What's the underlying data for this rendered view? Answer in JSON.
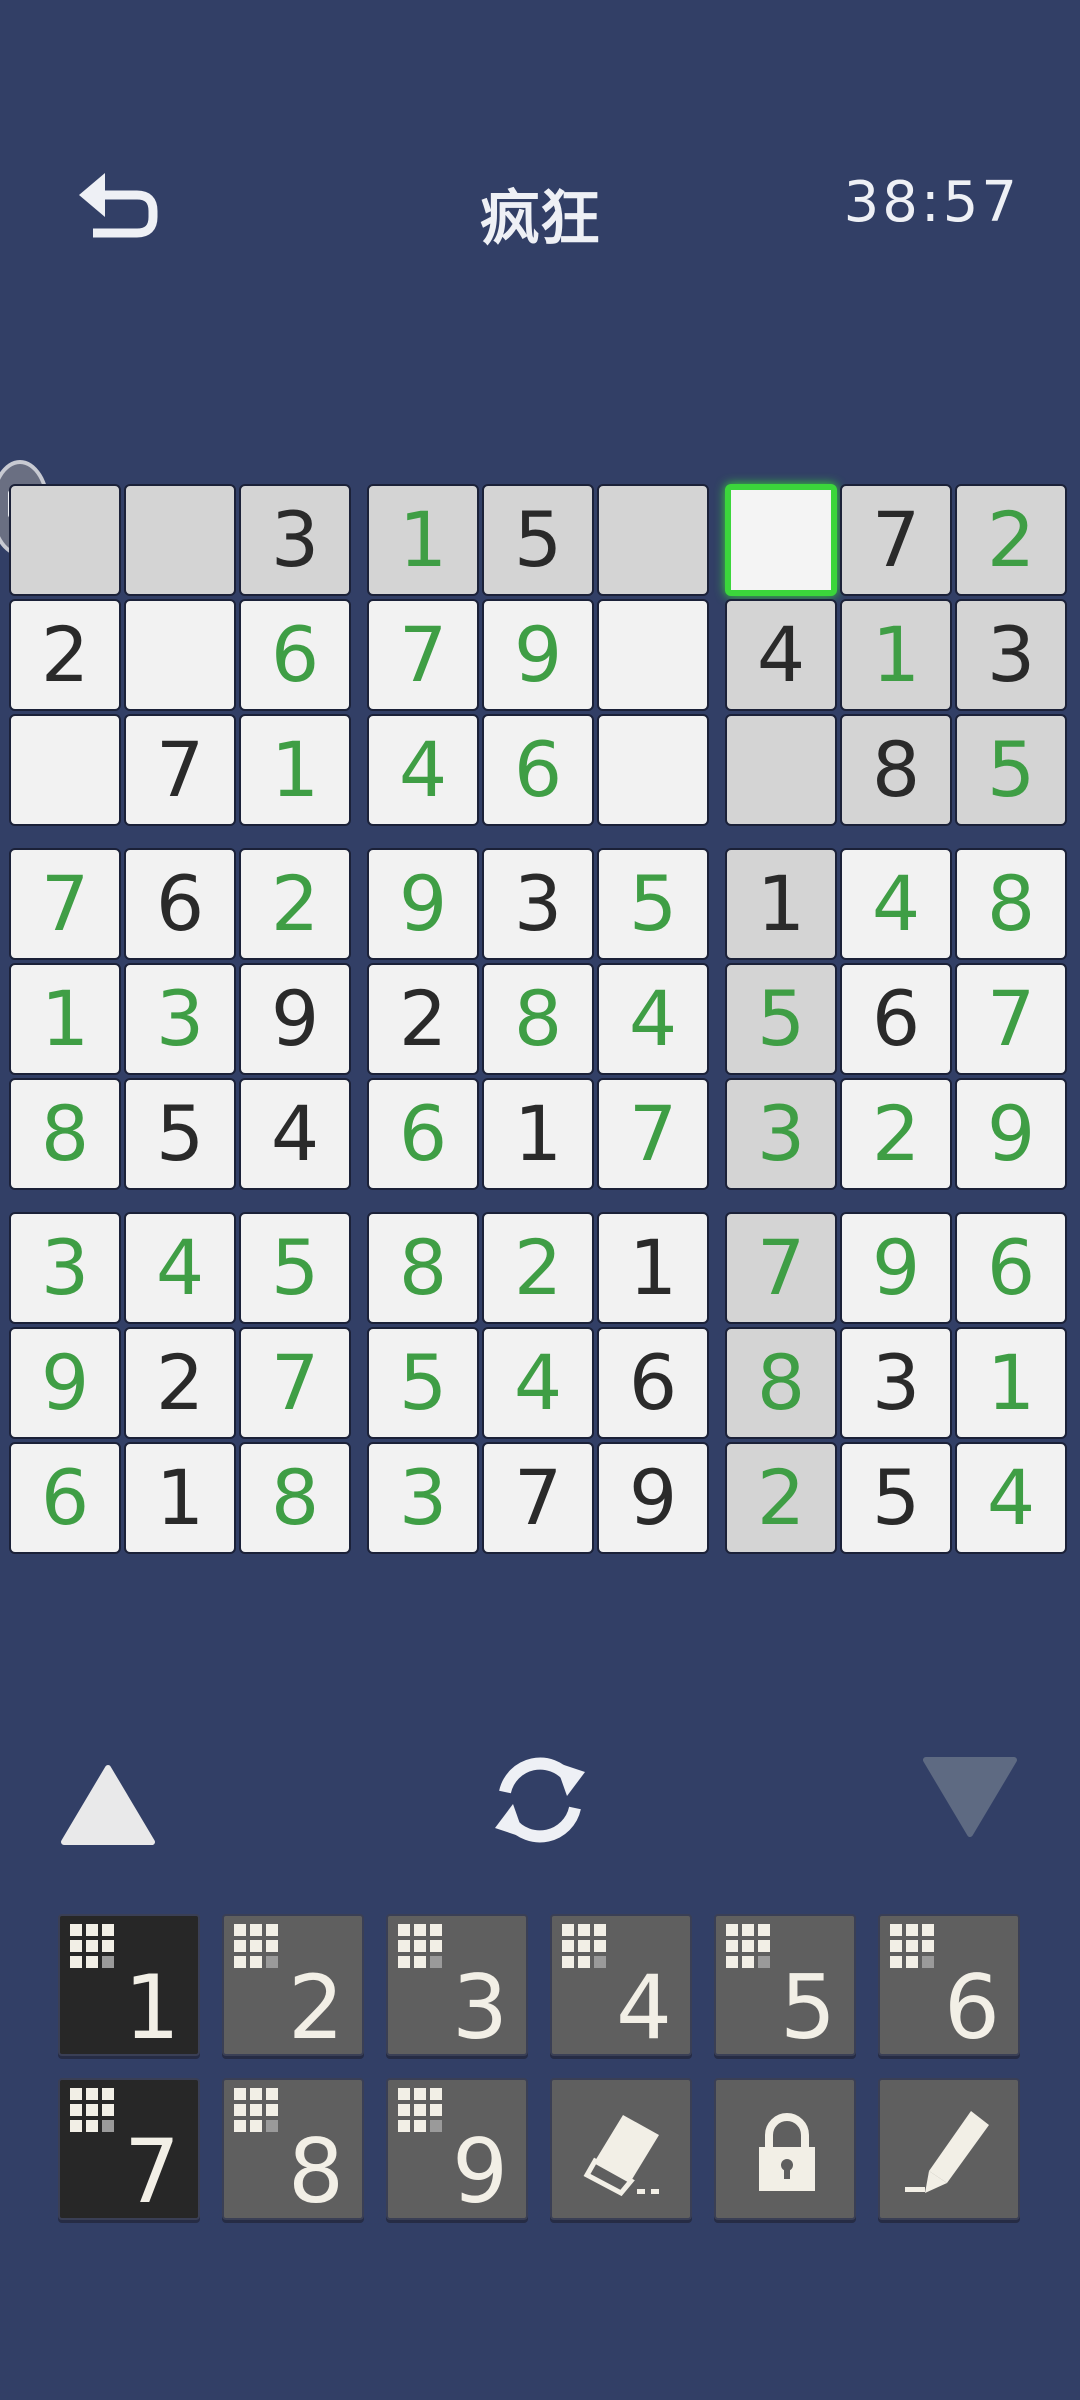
{
  "header": {
    "title": "疯狂",
    "timer": "38:57"
  },
  "grid": [
    [
      "",
      "",
      "3",
      "1",
      "5",
      "",
      "",
      "7",
      "2"
    ],
    [
      "2",
      "",
      "6",
      "7",
      "9",
      "",
      "4",
      "1",
      "3"
    ],
    [
      "",
      "7",
      "1",
      "4",
      "6",
      "",
      "",
      "8",
      "5"
    ],
    [
      "7",
      "6",
      "2",
      "9",
      "3",
      "5",
      "1",
      "4",
      "8"
    ],
    [
      "1",
      "3",
      "9",
      "2",
      "8",
      "4",
      "5",
      "6",
      "7"
    ],
    [
      "8",
      "5",
      "4",
      "6",
      "1",
      "7",
      "3",
      "2",
      "9"
    ],
    [
      "3",
      "4",
      "5",
      "8",
      "2",
      "1",
      "7",
      "9",
      "6"
    ],
    [
      "9",
      "2",
      "7",
      "5",
      "4",
      "6",
      "8",
      "3",
      "1"
    ],
    [
      "6",
      "1",
      "8",
      "3",
      "7",
      "9",
      "2",
      "5",
      "4"
    ]
  ],
  "user_entered": [
    [
      0,
      0,
      0,
      1,
      0,
      0,
      0,
      0,
      1
    ],
    [
      0,
      0,
      1,
      1,
      1,
      0,
      0,
      1,
      0
    ],
    [
      0,
      0,
      1,
      1,
      1,
      0,
      0,
      0,
      1
    ],
    [
      1,
      0,
      1,
      1,
      0,
      1,
      0,
      1,
      1
    ],
    [
      1,
      1,
      0,
      0,
      1,
      1,
      1,
      0,
      1
    ],
    [
      1,
      0,
      0,
      1,
      0,
      1,
      1,
      1,
      1
    ],
    [
      1,
      1,
      1,
      1,
      1,
      0,
      1,
      1,
      1
    ],
    [
      1,
      0,
      1,
      1,
      1,
      0,
      1,
      0,
      1
    ],
    [
      1,
      0,
      1,
      1,
      0,
      0,
      1,
      0,
      1
    ]
  ],
  "highlighted": [
    [
      1,
      1,
      1,
      1,
      1,
      1,
      0,
      1,
      1
    ],
    [
      0,
      0,
      0,
      0,
      0,
      0,
      1,
      1,
      1
    ],
    [
      0,
      0,
      0,
      0,
      0,
      0,
      1,
      1,
      1
    ],
    [
      0,
      0,
      0,
      0,
      0,
      0,
      1,
      0,
      0
    ],
    [
      0,
      0,
      0,
      0,
      0,
      0,
      1,
      0,
      0
    ],
    [
      0,
      0,
      0,
      0,
      0,
      0,
      1,
      0,
      0
    ],
    [
      0,
      0,
      0,
      0,
      0,
      0,
      1,
      0,
      0
    ],
    [
      0,
      0,
      0,
      0,
      0,
      0,
      1,
      0,
      0
    ],
    [
      0,
      0,
      0,
      0,
      0,
      0,
      1,
      0,
      0
    ]
  ],
  "selected_cell": {
    "row": 1,
    "col": 7
  },
  "colors": {
    "background": "#323f66",
    "given_digit": "#2a2a2a",
    "user_digit": "#3f9e45",
    "selection": "#3bd63b"
  },
  "numpad": {
    "digits": [
      "1",
      "2",
      "3",
      "4",
      "5",
      "6",
      "7",
      "8",
      "9"
    ],
    "active_digits": [
      "1",
      "7"
    ],
    "tools": [
      "eraser-icon",
      "lock-icon",
      "pencil-icon"
    ]
  },
  "controls": [
    "up-arrow-icon",
    "refresh-icon",
    "down-arrow-icon"
  ]
}
